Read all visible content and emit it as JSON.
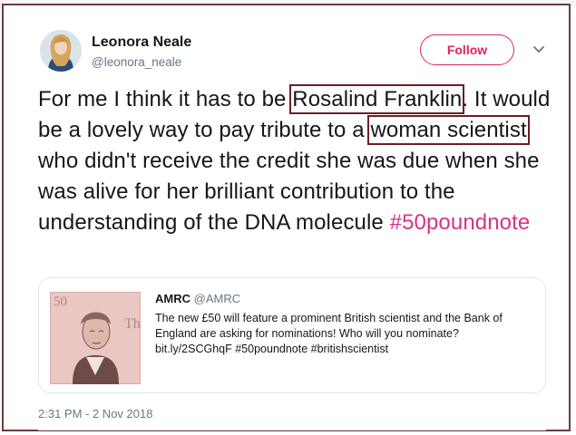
{
  "tweet": {
    "author_name": "Leonora Neale",
    "author_handle": "@leonora_neale",
    "follow_label": "Follow",
    "text_1": "For me I think it has to be ",
    "highlight_1": "Rosalind Franklin",
    "text_2": ". It would be a lovely way to pay tribute to a ",
    "highlight_2": "woman scientist",
    "text_3": " who didn't receive the credit she was due when she was alive for her brilliant contribution to the understanding of the DNA molecule ",
    "hashtag": "#50poundnote",
    "timestamp": "2:31 PM - 2 Nov 2018"
  },
  "quoted_tweet": {
    "author_name": "AMRC",
    "author_handle": "@AMRC",
    "text": "The new £50 will feature a prominent British scientist and the Bank of England are asking for nominations! Who will you nominate? bit.ly/2SCGhqF #50poundnote #britishscientist",
    "image_text": "50"
  },
  "colors": {
    "accent": "#e0245e",
    "hashtag": "#d63384",
    "highlight_box": "#6b1f24",
    "text": "#14171a",
    "muted": "#657786"
  },
  "icons": {
    "caret": "chevron-down-icon"
  }
}
